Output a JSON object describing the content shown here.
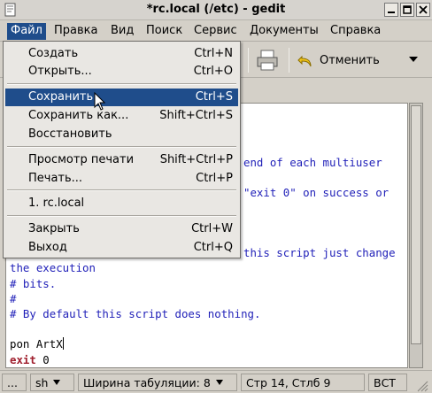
{
  "window": {
    "title": "*rc.local (/etc) - gedit"
  },
  "menubar": {
    "items": [
      {
        "label": "Файл"
      },
      {
        "label": "Правка"
      },
      {
        "label": "Вид"
      },
      {
        "label": "Поиск"
      },
      {
        "label": "Сервис"
      },
      {
        "label": "Документы"
      },
      {
        "label": "Справка"
      }
    ]
  },
  "toolbar": {
    "undo_label": "Отменить"
  },
  "file_menu": {
    "items": [
      {
        "label": "Создать",
        "accel": "Ctrl+N"
      },
      {
        "label": "Открыть...",
        "accel": "Ctrl+O"
      },
      {
        "label": "Сохранить",
        "accel": "Ctrl+S"
      },
      {
        "label": "Сохранить как...",
        "accel": "Shift+Ctrl+S"
      },
      {
        "label": "Восстановить",
        "accel": ""
      },
      {
        "label": "Просмотр печати",
        "accel": "Shift+Ctrl+P"
      },
      {
        "label": "Печать...",
        "accel": "Ctrl+P"
      },
      {
        "label": "1. rc.local",
        "accel": ""
      },
      {
        "label": "Закрыть",
        "accel": "Ctrl+W"
      },
      {
        "label": "Выход",
        "accel": "Ctrl+Q"
      }
    ]
  },
  "editor": {
    "lines": [
      {
        "text": "end of each multiuser",
        "style": "comment"
      },
      {
        "text": "\"exit 0\" on success or",
        "style": "comment"
      },
      {
        "text": "this script just change",
        "style": "comment"
      },
      {
        "text": "the execution",
        "style": "comment"
      },
      {
        "text": "# bits.",
        "style": "comment"
      },
      {
        "text": "#",
        "style": "comment"
      },
      {
        "text": "# By default this script does nothing.",
        "style": "comment"
      },
      {
        "text": "pon ArtX",
        "style": "plain"
      },
      {
        "text": "exit",
        "style": "kw"
      },
      {
        "text": " 0",
        "style": "plain"
      }
    ]
  },
  "statusbar": {
    "ellipsis": "...",
    "language": "sh",
    "tab_width": "Ширина табуляции: 8",
    "position": "Стр 14, Стлб 9",
    "mode": "ВСТ"
  },
  "colors": {
    "selection": "#1f4d8b",
    "comment": "#1f1fb8",
    "keyword": "#a0202e"
  }
}
